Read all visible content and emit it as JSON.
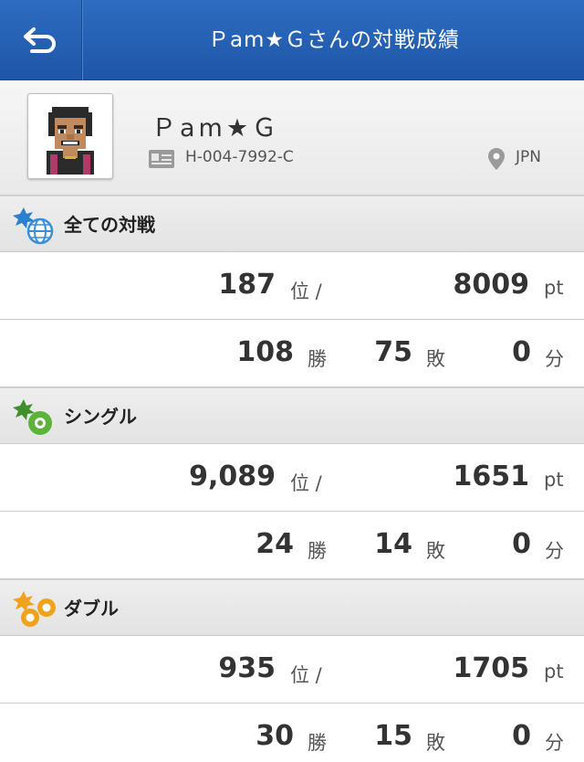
{
  "header": {
    "title": "Ｐam★Ｇさんの対戦成績",
    "back_icon": "back-arrow-icon"
  },
  "profile": {
    "name": "Ｐam★Ｇ",
    "player_id": "H-004-7992-C",
    "country": "JPN"
  },
  "sections": [
    {
      "title": "全ての対戦",
      "rank": "187",
      "rank_unit": "位 /",
      "points": "8009",
      "points_unit": "pt",
      "wins": "108",
      "wins_unit": "勝",
      "losses": "75",
      "losses_unit": "敗",
      "draws": "0",
      "draws_unit": "分"
    },
    {
      "title": "シングル",
      "rank": "9,089",
      "rank_unit": "位 /",
      "points": "1651",
      "points_unit": "pt",
      "wins": "24",
      "wins_unit": "勝",
      "losses": "14",
      "losses_unit": "敗",
      "draws": "0",
      "draws_unit": "分"
    },
    {
      "title": "ダブル",
      "rank": "935",
      "rank_unit": "位 /",
      "points": "1705",
      "points_unit": "pt",
      "wins": "30",
      "wins_unit": "勝",
      "losses": "15",
      "losses_unit": "敗",
      "draws": "0",
      "draws_unit": "分"
    }
  ],
  "colors": {
    "header_blue": "#2361b5",
    "all_icon_blue": "#3a8fd8",
    "single_icon_green": "#5bb33a",
    "double_icon_orange": "#f0a21c"
  }
}
